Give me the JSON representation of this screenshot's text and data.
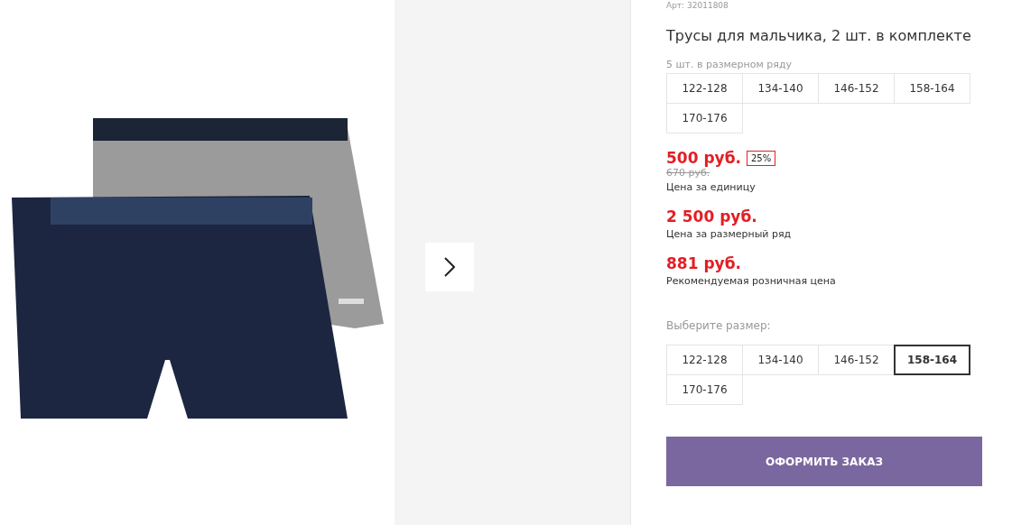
{
  "article": "Арт: 32011808",
  "title": "Трусы для мальчика, 2 шт. в комплекте",
  "pack_label": "5 шт. в размерном ряду",
  "pack_sizes": [
    "122-128",
    "134-140",
    "146-152",
    "158-164",
    "170-176"
  ],
  "unit_price": {
    "price": "500 руб.",
    "discount": "25%",
    "old_price": "670 руб.",
    "caption": "Цена за единицу"
  },
  "series_price": {
    "price": "2 500 руб.",
    "caption": "Цена за размерный ряд"
  },
  "retail_price": {
    "price": "881 руб.",
    "caption": "Рекомендуемая розничная цена"
  },
  "size_label": "Выберите размер:",
  "sizes": [
    {
      "label": "122-128",
      "selected": false
    },
    {
      "label": "134-140",
      "selected": false
    },
    {
      "label": "146-152",
      "selected": false
    },
    {
      "label": "158-164",
      "selected": true
    },
    {
      "label": "170-176",
      "selected": false
    }
  ],
  "order_button": "ОФОРМИТЬ ЗАКАЗ"
}
